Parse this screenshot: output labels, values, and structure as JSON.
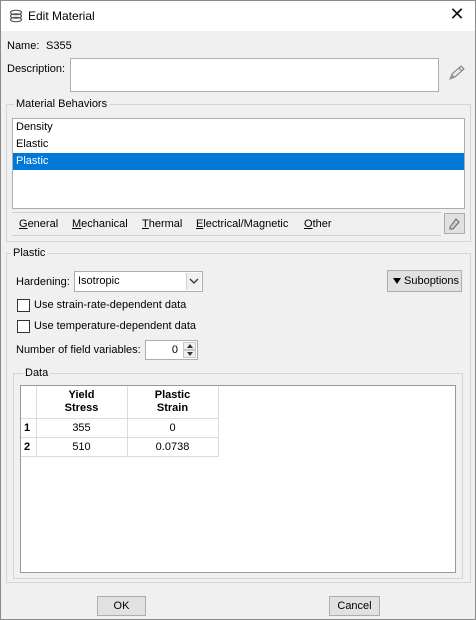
{
  "window": {
    "title": "Edit Material",
    "close_glyph": "✕"
  },
  "name": {
    "label": "Name:",
    "value": "S355"
  },
  "description": {
    "label": "Description:",
    "value": ""
  },
  "material_behaviors": {
    "title": "Material Behaviors",
    "items": [
      {
        "label": "Density",
        "selected": false
      },
      {
        "label": "Elastic",
        "selected": false
      },
      {
        "label": "Plastic",
        "selected": true
      }
    ]
  },
  "menu": {
    "items": [
      {
        "label": "General",
        "mnemonic": "G"
      },
      {
        "label": "Mechanical",
        "mnemonic": "M"
      },
      {
        "label": "Thermal",
        "mnemonic": "T"
      },
      {
        "label": "Electrical/Magnetic",
        "mnemonic": "E"
      },
      {
        "label": "Other",
        "mnemonic": "O"
      }
    ]
  },
  "plastic": {
    "title": "Plastic",
    "hardening_label": "Hardening:",
    "hardening_value": "Isotropic",
    "suboptions_label": "Suboptions",
    "strain_rate_label": "Use strain-rate-dependent data",
    "strain_rate_checked": false,
    "temperature_label": "Use temperature-dependent data",
    "temperature_checked": false,
    "field_vars_label": "Number of field variables:",
    "field_vars_value": "0"
  },
  "data_table": {
    "title": "Data",
    "columns": [
      {
        "line1": "Yield",
        "line2": "Stress"
      },
      {
        "line1": "Plastic",
        "line2": "Strain"
      }
    ],
    "rows": [
      {
        "index": "1",
        "yield_stress": "355",
        "plastic_strain": "0"
      },
      {
        "index": "2",
        "yield_stress": "510",
        "plastic_strain": "0.0738"
      }
    ]
  },
  "buttons": {
    "ok": "OK",
    "cancel": "Cancel"
  },
  "colors": {
    "selection": "#0078d7",
    "window_bg": "#f0f0f0"
  }
}
